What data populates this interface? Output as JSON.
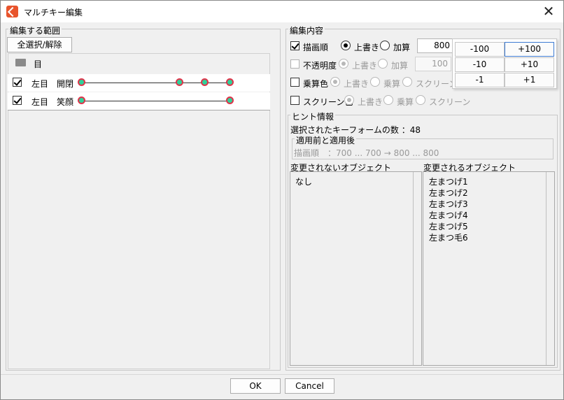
{
  "window": {
    "title": "マルチキー編集",
    "close_icon": "close-icon"
  },
  "left": {
    "group_title": "編集する範囲",
    "select_all_label": "全選択/解除",
    "folder_label": "目",
    "rows": [
      {
        "col1": "左目",
        "col2": "開閉",
        "checked": true
      },
      {
        "col1": "左目",
        "col2": "笑顔",
        "checked": true
      }
    ]
  },
  "right": {
    "group_title": "編集内容",
    "draw_order": {
      "label": "描画順",
      "opt1": "上書き",
      "opt2": "加算",
      "value": "800"
    },
    "opacity": {
      "label": "不透明度",
      "opt1": "上書き",
      "opt2": "加算",
      "value": "100"
    },
    "multiply": {
      "label": "乗算色",
      "opt1": "上書き",
      "opt2": "乗算",
      "opt3": "スクリーン"
    },
    "screen": {
      "label": "スクリーン色",
      "opt1": "上書き",
      "opt2": "乗算",
      "opt3": "スクリーン"
    },
    "popup": {
      "b1": "-100",
      "b2": "+100",
      "b3": "-10",
      "b4": "+10",
      "b5": "-1",
      "b6": "+1"
    },
    "hint": {
      "title": "ヒント情報",
      "count_label": "選択されたキーフォームの数 ：48",
      "before_after_title": "適用前と適用後",
      "before_after_text": "描画順　：700 ... 700 → 800 ... 800",
      "unchanged_title": "変更されないオブジェクト",
      "changed_title": "変更されるオブジェクト",
      "unchanged_items": [
        "なし"
      ],
      "changed_items": [
        "左まつげ1",
        "左まつげ2",
        "左まつげ3",
        "左まつげ4",
        "左まつげ5",
        "左まつ毛6"
      ]
    }
  },
  "footer": {
    "ok_label": "OK",
    "cancel_label": "Cancel"
  },
  "colors": {
    "accent": "#e8542c",
    "key_fill": "#2fd19a",
    "key_border": "#e0334a"
  }
}
